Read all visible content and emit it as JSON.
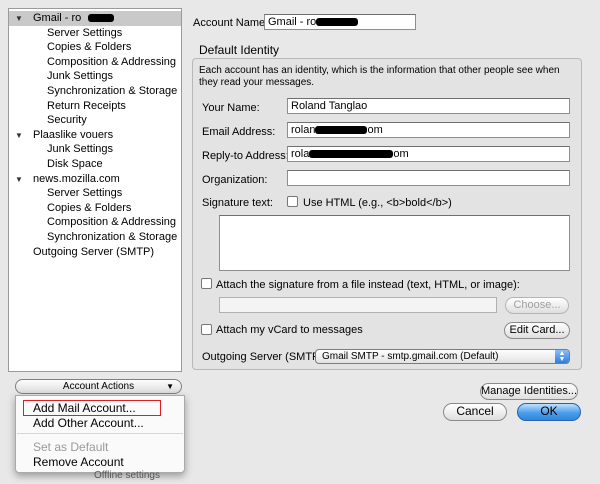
{
  "sidebar": {
    "items": [
      {
        "label": "Gmail - ro",
        "level": 0,
        "expanded": true,
        "selected": true,
        "redacted": true
      },
      {
        "label": "Server Settings",
        "level": 1
      },
      {
        "label": "Copies & Folders",
        "level": 1
      },
      {
        "label": "Composition & Addressing",
        "level": 1
      },
      {
        "label": "Junk Settings",
        "level": 1
      },
      {
        "label": "Synchronization & Storage",
        "level": 1
      },
      {
        "label": "Return Receipts",
        "level": 1
      },
      {
        "label": "Security",
        "level": 1
      },
      {
        "label": "Plaaslike vouers",
        "level": 0,
        "expanded": true
      },
      {
        "label": "Junk Settings",
        "level": 1
      },
      {
        "label": "Disk Space",
        "level": 1
      },
      {
        "label": "news.mozilla.com",
        "level": 0,
        "expanded": true
      },
      {
        "label": "Server Settings",
        "level": 1
      },
      {
        "label": "Copies & Folders",
        "level": 1
      },
      {
        "label": "Composition & Addressing",
        "level": 1
      },
      {
        "label": "Synchronization & Storage",
        "level": 1
      },
      {
        "label": "Outgoing Server (SMTP)",
        "level": 0,
        "expanded": false
      }
    ]
  },
  "account_actions": {
    "label": "Account Actions",
    "menu": [
      {
        "label": "Add Mail Account...",
        "enabled": true,
        "highlighted": true
      },
      {
        "label": "Add Other Account...",
        "enabled": true
      },
      {
        "label": "Set as Default",
        "enabled": false
      },
      {
        "label": "Remove Account",
        "enabled": true
      }
    ],
    "partial_text": "Offline settings"
  },
  "account": {
    "name_label": "Account Name:",
    "name_value": "Gmail - ro"
  },
  "identity": {
    "title": "Default Identity",
    "description": "Each account has an identity, which is the information that other people see when they read your messages.",
    "your_name_label": "Your Name:",
    "your_name_value": "Roland Tanglao",
    "email_label": "Email Address:",
    "email_prefix": "rolan",
    "email_suffix": "om",
    "replyto_label": "Reply-to Address:",
    "replyto_prefix": "rola",
    "replyto_suffix": "om",
    "org_label": "Organization:",
    "org_value": "",
    "sig_label": "Signature text:",
    "use_html_label": "Use HTML (e.g., <b>bold</b>)",
    "sig_value": "",
    "attach_sig_label": "Attach the signature from a file instead (text, HTML, or image):",
    "sig_file_value": "",
    "choose_label": "Choose...",
    "vcard_label": "Attach my vCard to messages",
    "edit_card_label": "Edit Card...",
    "smtp_label": "Outgoing Server (SMTP):",
    "smtp_value": "Gmail SMTP - smtp.gmail.com (Default)"
  },
  "footer": {
    "manage_label": "Manage Identities...",
    "cancel_label": "Cancel",
    "ok_label": "OK"
  }
}
